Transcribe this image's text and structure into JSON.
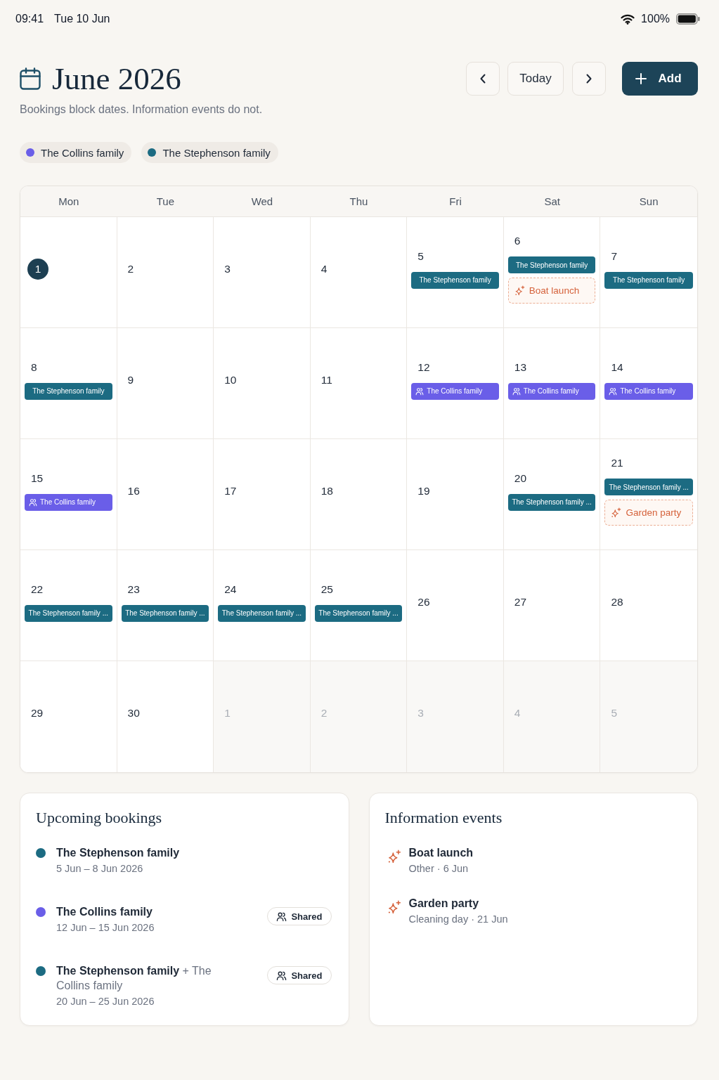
{
  "status_bar": {
    "time": "09:41",
    "date": "Tue 10 Jun",
    "battery": "100%"
  },
  "header": {
    "title": "June 2026",
    "subtitle": "Bookings block dates. Information events do not.",
    "buttons": [
      {
        "kind": "prev"
      },
      {
        "kind": "today",
        "label": "Today"
      },
      {
        "kind": "next"
      },
      {
        "kind": "add",
        "label": "Add"
      }
    ]
  },
  "legend": [
    {
      "label": "The Collins family",
      "color": "#6a5ee8"
    },
    {
      "label": "The Stephenson family",
      "color": "#1c6b82"
    }
  ],
  "calendar": {
    "weekdays": [
      "Mon",
      "Tue",
      "Wed",
      "Thu",
      "Fri",
      "Sat",
      "Sun"
    ],
    "weeks": [
      [
        {
          "day": "1",
          "selected": true,
          "in_month": true
        },
        {
          "day": "2",
          "selected": false,
          "in_month": true
        },
        {
          "day": "3",
          "selected": false,
          "in_month": true
        },
        {
          "day": "4",
          "selected": false,
          "in_month": true
        },
        {
          "day": "5",
          "selected": false,
          "in_month": true,
          "events": [
            {
              "kind": "booking",
              "label": "The Stephenson family",
              "color": "#1c6b82",
              "shared": false
            }
          ]
        },
        {
          "day": "6",
          "selected": false,
          "in_month": true,
          "events": [
            {
              "kind": "booking",
              "label": "The Stephenson family",
              "color": "#1c6b82",
              "shared": false
            },
            {
              "kind": "info",
              "label": "Boat launch"
            }
          ]
        },
        {
          "day": "7",
          "selected": false,
          "in_month": true,
          "events": [
            {
              "kind": "booking",
              "label": "The Stephenson family",
              "color": "#1c6b82",
              "shared": false
            }
          ]
        }
      ],
      [
        {
          "day": "8",
          "selected": false,
          "in_month": true,
          "events": [
            {
              "kind": "booking",
              "label": "The Stephenson family",
              "color": "#1c6b82",
              "shared": false
            }
          ]
        },
        {
          "day": "9",
          "selected": false,
          "in_month": true
        },
        {
          "day": "10",
          "selected": false,
          "in_month": true
        },
        {
          "day": "11",
          "selected": false,
          "in_month": true
        },
        {
          "day": "12",
          "selected": false,
          "in_month": true,
          "events": [
            {
              "kind": "booking",
              "label": "The Collins family",
              "color": "#6a5ee8",
              "shared": true
            }
          ]
        },
        {
          "day": "13",
          "selected": false,
          "in_month": true,
          "events": [
            {
              "kind": "booking",
              "label": "The Collins family",
              "color": "#6a5ee8",
              "shared": true
            }
          ]
        },
        {
          "day": "14",
          "selected": false,
          "in_month": true,
          "events": [
            {
              "kind": "booking",
              "label": "The Collins family",
              "color": "#6a5ee8",
              "shared": true
            }
          ]
        }
      ],
      [
        {
          "day": "15",
          "selected": false,
          "in_month": true,
          "events": [
            {
              "kind": "booking",
              "label": "The Collins family",
              "color": "#6a5ee8",
              "shared": true
            }
          ]
        },
        {
          "day": "16",
          "selected": false,
          "in_month": true
        },
        {
          "day": "17",
          "selected": false,
          "in_month": true
        },
        {
          "day": "18",
          "selected": false,
          "in_month": true
        },
        {
          "day": "19",
          "selected": false,
          "in_month": true
        },
        {
          "day": "20",
          "selected": false,
          "in_month": true,
          "events": [
            {
              "kind": "booking",
              "label": "The Stephenson family ...",
              "color": "#1c6b82",
              "shared": false
            }
          ]
        },
        {
          "day": "21",
          "selected": false,
          "in_month": true,
          "events": [
            {
              "kind": "booking",
              "label": "The Stephenson family ...",
              "color": "#1c6b82",
              "shared": false
            },
            {
              "kind": "info",
              "label": "Garden party"
            }
          ]
        }
      ],
      [
        {
          "day": "22",
          "selected": false,
          "in_month": true,
          "events": [
            {
              "kind": "booking",
              "label": "The Stephenson family ...",
              "color": "#1c6b82",
              "shared": false
            }
          ]
        },
        {
          "day": "23",
          "selected": false,
          "in_month": true,
          "events": [
            {
              "kind": "booking",
              "label": "The Stephenson family ...",
              "color": "#1c6b82",
              "shared": false
            }
          ]
        },
        {
          "day": "24",
          "selected": false,
          "in_month": true,
          "events": [
            {
              "kind": "booking",
              "label": "The Stephenson family ...",
              "color": "#1c6b82",
              "shared": false
            }
          ]
        },
        {
          "day": "25",
          "selected": false,
          "in_month": true,
          "events": [
            {
              "kind": "booking",
              "label": "The Stephenson family ...",
              "color": "#1c6b82",
              "shared": false
            }
          ]
        },
        {
          "day": "26",
          "selected": false,
          "in_month": true
        },
        {
          "day": "27",
          "selected": false,
          "in_month": true
        },
        {
          "day": "28",
          "selected": false,
          "in_month": true
        }
      ],
      [
        {
          "day": "29",
          "selected": false,
          "in_month": true
        },
        {
          "day": "30",
          "selected": false,
          "in_month": true
        },
        {
          "day": "1",
          "selected": false,
          "in_month": false
        },
        {
          "day": "2",
          "selected": false,
          "in_month": false
        },
        {
          "day": "3",
          "selected": false,
          "in_month": false
        },
        {
          "day": "4",
          "selected": false,
          "in_month": false
        },
        {
          "day": "5",
          "selected": false,
          "in_month": false
        }
      ]
    ]
  },
  "bookings": {
    "title": "Upcoming bookings",
    "items": [
      {
        "name": "The Stephenson family",
        "dates": "5 Jun – 8 Jun 2026",
        "color": "#1c6b82"
      },
      {
        "name": "The Collins family",
        "dates": "12 Jun – 15 Jun 2026",
        "color": "#6a5ee8",
        "badge": "Shared"
      },
      {
        "name": "The Stephenson family",
        "partner": "+ The Collins family",
        "dates": "20 Jun – 25 Jun 2026",
        "color": "#1c6b82",
        "badge": "Shared"
      }
    ]
  },
  "info_events": {
    "title": "Information events",
    "items": [
      {
        "name": "Boat launch",
        "detail": "Other · 6 Jun"
      },
      {
        "name": "Garden party",
        "detail": "Cleaning day · 21 Jun"
      }
    ]
  }
}
